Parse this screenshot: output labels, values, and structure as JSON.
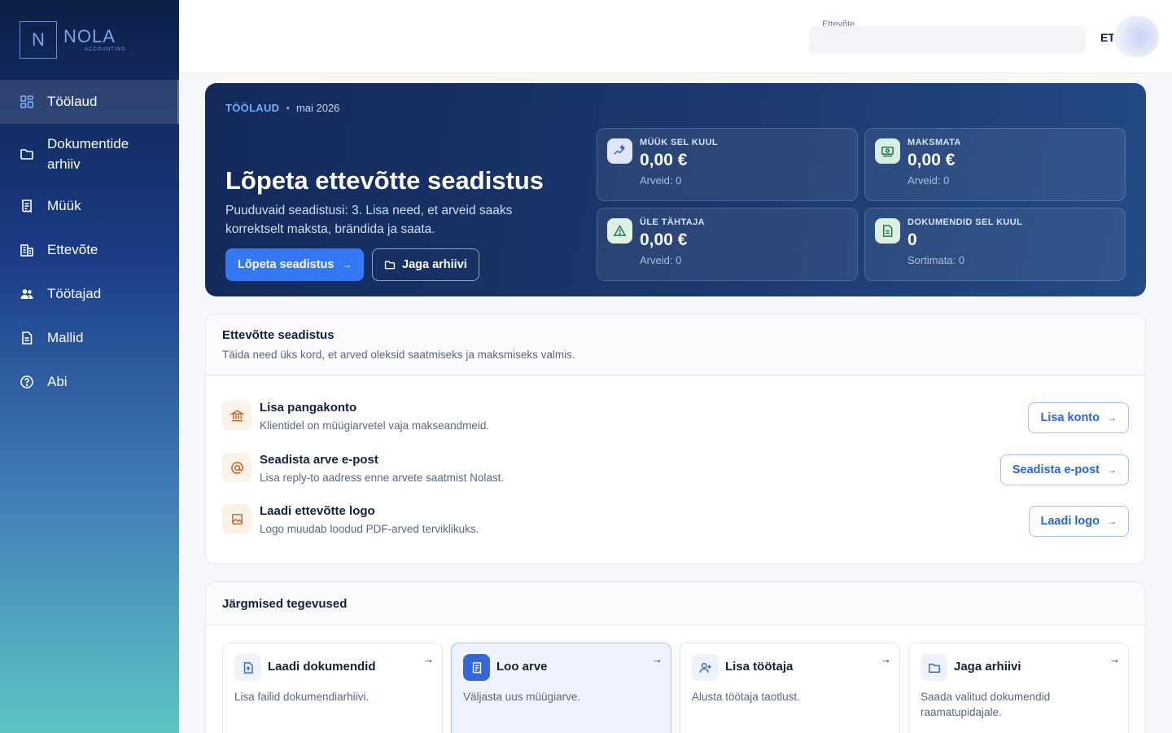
{
  "brand": {
    "letter": "N",
    "name": "NOLA",
    "sub": "ACCOUNTING"
  },
  "sidebar": {
    "items": [
      {
        "label": "Töölaud",
        "icon": "dashboard-icon"
      },
      {
        "label": "Dokumentide arhiiv",
        "icon": "folder-icon"
      },
      {
        "label": "Müük",
        "icon": "receipt-icon"
      },
      {
        "label": "Ettevõte",
        "icon": "building-icon"
      },
      {
        "label": "Töötajad",
        "icon": "users-icon"
      },
      {
        "label": "Mallid",
        "icon": "template-icon"
      },
      {
        "label": "Abi",
        "icon": "help-icon"
      }
    ]
  },
  "header": {
    "company_label": "Ettevõte",
    "language": "ET"
  },
  "hero": {
    "crumb_section": "TÖÖLAUD",
    "crumb_period": "mai 2026",
    "title": "Lõpeta ettevõtte seadistus",
    "subtitle": "Puuduvaid seadistusi: 3. Lisa need, et arveid saaks korrektselt maksta, brändida ja saata.",
    "primary_btn": "Lõpeta seadistus",
    "secondary_btn": "Jaga arhiivi"
  },
  "stats": [
    {
      "label": "MÜÜK SEL KUUL",
      "value": "0,00 €",
      "sub": "Arveid: 0",
      "icon": "sparkle-chart-icon",
      "color": "#dfe6f7"
    },
    {
      "label": "MAKSMATA",
      "value": "0,00 €",
      "sub": "Arveid: 0",
      "icon": "cash-icon",
      "color": "#d7efe0"
    },
    {
      "label": "ÜLE TÄHTAJA",
      "value": "0,00 €",
      "sub": "Arveid: 0",
      "icon": "warning-icon",
      "color": "#dff1e3"
    },
    {
      "label": "DOKUMENDID SEL KUUL",
      "value": "0",
      "sub": "Sortimata: 0",
      "icon": "document-icon",
      "color": "#dcefe0"
    }
  ],
  "setup": {
    "title": "Ettevõtte seadistus",
    "description": "Täida need üks kord, et arved oleksid saatmiseks ja maksmiseks valmis.",
    "tasks": [
      {
        "title": "Lisa pangakonto",
        "desc": "Klientidel on müügiarvetel vaja makseandmeid.",
        "button": "Lisa konto",
        "icon": "bank-icon"
      },
      {
        "title": "Seadista arve e-post",
        "desc": "Lisa reply-to aadress enne arvete saatmist Nolast.",
        "button": "Seadista e-post",
        "icon": "at-icon"
      },
      {
        "title": "Laadi ettevõtte logo",
        "desc": "Logo muudab loodud PDF-arved terviklikuks.",
        "button": "Laadi logo",
        "icon": "image-icon"
      }
    ]
  },
  "next": {
    "title": "Järgmised tegevused",
    "actions": [
      {
        "title": "Laadi dokumendid",
        "desc": "Lisa failid dokumendiarhiivi.",
        "icon": "upload-file-icon"
      },
      {
        "title": "Loo arve",
        "desc": "Väljasta uus müügiarve.",
        "icon": "invoice-icon"
      },
      {
        "title": "Lisa töötaja",
        "desc": "Alusta töötaja taotlust.",
        "icon": "add-user-icon"
      },
      {
        "title": "Jaga arhiivi",
        "desc": "Saada valitud dokumendid raamatupidajale.",
        "icon": "folder-icon"
      }
    ]
  }
}
